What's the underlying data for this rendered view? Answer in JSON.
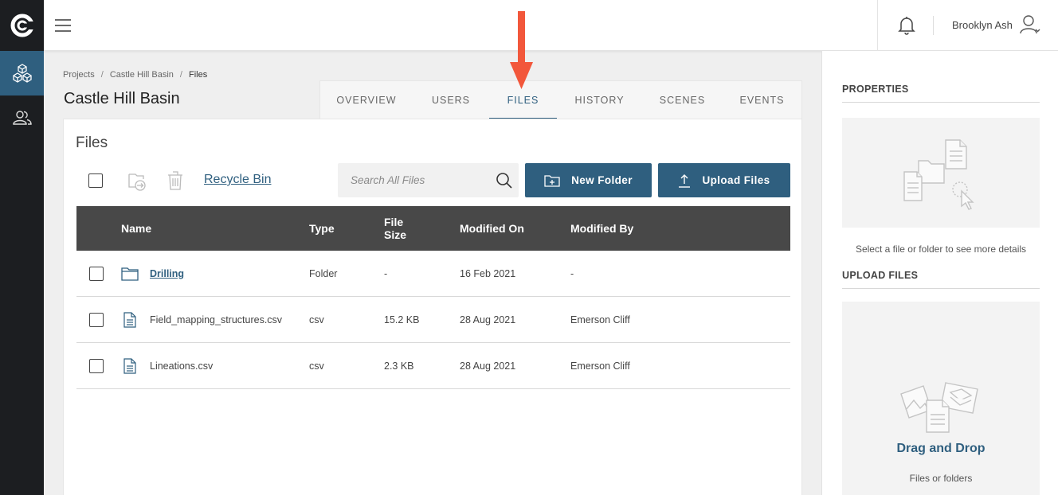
{
  "app": {
    "logo_letter": "C"
  },
  "header": {
    "user_name": "Brooklyn Ash"
  },
  "breadcrumb": {
    "items": [
      "Projects",
      "Castle Hill Basin",
      "Files"
    ]
  },
  "page": {
    "title": "Castle Hill Basin"
  },
  "tabs": [
    {
      "label": "OVERVIEW",
      "active": false
    },
    {
      "label": "USERS",
      "active": false
    },
    {
      "label": "FILES",
      "active": true
    },
    {
      "label": "HISTORY",
      "active": false
    },
    {
      "label": "SCENES",
      "active": false
    },
    {
      "label": "EVENTS",
      "active": false
    }
  ],
  "files_panel": {
    "title": "Files",
    "recycle_bin": "Recycle Bin",
    "search_placeholder": "Search All Files",
    "new_folder": "New Folder",
    "upload_files": "Upload Files"
  },
  "table": {
    "columns": {
      "name": "Name",
      "type": "Type",
      "size_line1": "File",
      "size_line2": "Size",
      "modified_on": "Modified On",
      "modified_by": "Modified By"
    },
    "rows": [
      {
        "name": "Drilling",
        "type": "Folder",
        "size": "-",
        "modified_on": "16 Feb 2021",
        "modified_by": "-",
        "kind": "folder"
      },
      {
        "name": "Field_mapping_structures.csv",
        "type": "csv",
        "size": "15.2 KB",
        "modified_on": "28 Aug 2021",
        "modified_by": "Emerson Cliff",
        "kind": "file"
      },
      {
        "name": "Lineations.csv",
        "type": "csv",
        "size": "2.3 KB",
        "modified_on": "28 Aug 2021",
        "modified_by": "Emerson Cliff",
        "kind": "file"
      }
    ]
  },
  "side": {
    "properties_heading": "PROPERTIES",
    "properties_hint": "Select a file or folder to see more details",
    "upload_heading": "UPLOAD FILES",
    "drag_title": "Drag and Drop",
    "drag_sub": "Files or folders"
  },
  "colors": {
    "accent": "#2f5f7f",
    "rail": "#1c1e21",
    "annotation_arrow": "#f2573b"
  }
}
